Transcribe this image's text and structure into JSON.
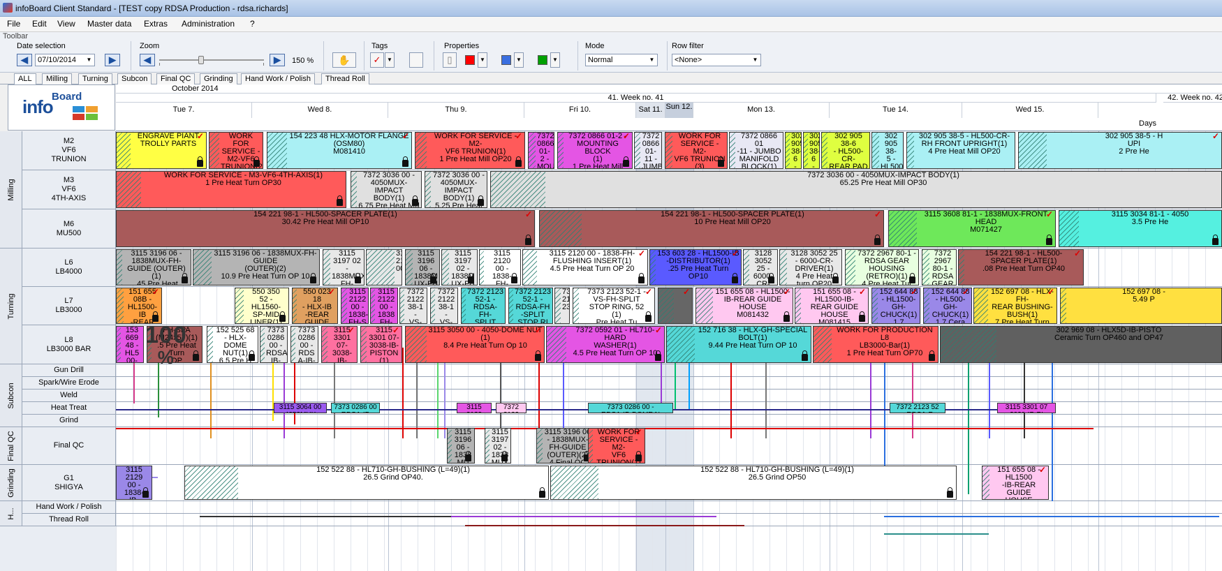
{
  "window": {
    "title": "infoBoard Client Standard - [TEST copy RDSA Production - rdsa.richards]"
  },
  "menu": [
    "File",
    "Edit",
    "View",
    "Master data",
    "Extras",
    "Administration",
    "?"
  ],
  "toolbar": {
    "label": "Toolbar",
    "date_selection": {
      "label": "Date selection",
      "value": "07/10/2014"
    },
    "zoom": {
      "label": "Zoom",
      "value": "150 %",
      "level_fraction": 0.4
    },
    "tags": {
      "label": "Tags"
    },
    "properties": {
      "label": "Properties",
      "colors": [
        "#ff0000",
        "#3a6fe0",
        "#00a000"
      ]
    },
    "mode": {
      "label": "Mode",
      "value": "Normal"
    },
    "row_filter": {
      "label": "Row filter",
      "value": "<None>"
    }
  },
  "tabs": [
    "ALL",
    "Milling",
    "Turning",
    "Subcon",
    "Final QC",
    "Grinding",
    "Hand Work / Polish",
    "Thread Roll"
  ],
  "logo": {
    "text_main": "info",
    "text_sup": "Board"
  },
  "timeline": {
    "month": "October 2014",
    "weeks": [
      {
        "label": "41. Week no. 41"
      },
      {
        "label": "42. Week no. 42"
      }
    ],
    "days": [
      "Tue 7.",
      "Wed 8.",
      "Thu 9.",
      "Fri 10.",
      "Sat 11.",
      "Sun 12.",
      "Mon 13.",
      "Tue 14.",
      "Wed 15."
    ],
    "unit": "Days"
  },
  "groups": [
    "Milling",
    "Turning",
    "Subcon",
    "Final QC",
    "Grinding",
    "H..."
  ],
  "rows": [
    {
      "label": "M2\nVF6\nTRUNION"
    },
    {
      "label": "M3\nVF6\n4TH-AXIS"
    },
    {
      "label": "M6\nMU500"
    },
    {
      "label": "L6\nLB4000"
    },
    {
      "label": "L7\nLB3000"
    },
    {
      "label": "L8\nLB3000 BAR"
    },
    {
      "label": "Gun Drill"
    },
    {
      "label": "Spark/Wire Erode"
    },
    {
      "label": "Weld"
    },
    {
      "label": "Heat Treat"
    },
    {
      "label": "Grind"
    },
    {
      "label": "Final QC"
    },
    {
      "label": "G1\nSHIGYA"
    },
    {
      "label": "Hand Work / Polish"
    },
    {
      "label": "Thread Roll"
    }
  ],
  "progress_overlay": {
    "value": "100",
    "unit": "%"
  },
  "jobs": [
    {
      "row": 0,
      "text": "ENGRAVE PIANT\nTROLLY PARTS",
      "color": "#ffff44"
    },
    {
      "row": 0,
      "text": "WORK FOR\nSERVICE -\nM2-VF6\nTRUNION(2)\n1 Pre Heat",
      "color": "#ff5a5a"
    },
    {
      "row": 0,
      "text": "154 223 48 HLX-MOTOR FLANGE\n(OSM80)\nM081410",
      "color": "#aaf0f4"
    },
    {
      "row": 0,
      "text": "WORK FOR SERVICE - M2-\nVF6 TRUNION(1)\n1 Pre Heat Mill OP20",
      "color": "#ff5a5a"
    },
    {
      "row": 0,
      "text": "7372\n0866\n01-2 -\nMOU\nNTI",
      "color": "#e455e4"
    },
    {
      "row": 0,
      "text": "7372 0866 01-2 -\nMOUNTING BLOCK\n(1)\n1 Pre Heat Mill\nOP20",
      "color": "#e455e4"
    },
    {
      "row": 0,
      "text": "7372\n0866\n01-11 -\nJUMBO\nMANI",
      "color": "#e8e8f4"
    },
    {
      "row": 0,
      "text": "WORK FOR\nSERVICE - M2-\nVF6 TRUNION\n(3)\n1 Pre Heat",
      "color": "#ff5a5a"
    },
    {
      "row": 0,
      "text": "7372 0866 01\n-11 - JUMBO\nMANIFOLD\nBLOCK(1)\n1 Pre Heat",
      "color": "#e8e8f4"
    },
    {
      "row": 0,
      "text": "302\n905\n38-\n6 -\nHL",
      "color": "#dfff40"
    },
    {
      "row": 0,
      "text": "302\n905\n38-\n6 -\nHL",
      "color": "#dfff40"
    },
    {
      "row": 0,
      "text": "302 905 38-6\n- HL500-CR-\nREAR PAD\n(1)\n2 Pre Heat",
      "color": "#dfff40"
    },
    {
      "row": 0,
      "text": "302\n905 38-\n5 -\nHL500-\nCR-R",
      "color": "#aaf0f4"
    },
    {
      "row": 0,
      "text": "302 905 38-5 - HL500-CR-\nRH FRONT UPRIGHT(1)\n4 Pre Heat Mill OP20",
      "color": "#aaf0f4"
    },
    {
      "row": 0,
      "text": "302 905 38-5 - H\nUPI\n2 Pre He",
      "color": "#aaf0f4"
    },
    {
      "row": 1,
      "text": "WORK FOR SERVICE - M3-VF6-4TH-AXIS(1)\n1 Pre Heat Turn OP30",
      "color": "#ff5a5a"
    },
    {
      "row": 1,
      "text": "7372 3036 00 -\n4050MUX-IMPACT\nBODY(1)\n6.75 Pre Heat Mill\nOP10",
      "color": "#e0e0e0"
    },
    {
      "row": 1,
      "text": "7372 3036 00 -\n4050MUX-\nIMPACT BODY(1)\n5.25 Pre Heat Mill\nOP20",
      "color": "#e0e0e0"
    },
    {
      "row": 1,
      "text": "7372 3036 00 - 4050MUX-IMPACT BODY(1)\n65.25 Pre Heat Mill OP30",
      "color": "#e0e0e0"
    },
    {
      "row": 2,
      "text": "154 221 98-1 - HL500-SPACER PLATE(1)\n30.42 Pre Heat Mill OP10",
      "color": "#a85a5a"
    },
    {
      "row": 2,
      "text": "154 221 98-1 - HL500-SPACER PLATE(1)\n10 Pre Heat Mill OP20",
      "color": "#a85a5a"
    },
    {
      "row": 2,
      "text": "3115 3608 81-1 - 1838MUX-FRONT HEAD\nM071427",
      "color": "#6ee85a"
    },
    {
      "row": 2,
      "text": "3115 3034 81-1 - 4050\n3.5 Pre He",
      "color": "#55f0e0"
    },
    {
      "row": 3,
      "text": "3115 3196 06 -\n1838MUX-FH-\nGUIDE (OUTER)\n(1)\n.45 Pre Heat",
      "color": "#b4b4b4"
    },
    {
      "row": 3,
      "text": "3115 3196 06 - 1838MUX-FH-GUIDE\n(OUTER)(2)\n10.9 Pre Heat Turn OP 10",
      "color": "#b4b4b4"
    },
    {
      "row": 3,
      "text": "3115 3197 02\n- 1838MUX-\nFH-GUIDE\n(INNER)(2)\n4 Pre Hea",
      "color": "#e8e8e8"
    },
    {
      "row": 3,
      "text": "3115\n2120\n00",
      "color": "#e8e8e8"
    },
    {
      "row": 3,
      "text": "3115\n3196\n06 -\n1838M\nUX-FH",
      "color": "#b4b4b4"
    },
    {
      "row": 3,
      "text": "3115\n3197\n02 -\n1838M\nUX-FH",
      "color": "#e8e8e8"
    },
    {
      "row": 3,
      "text": "3115 2120\n00 - 1838-\nFH-\nFLUSHIN\nG INSERT",
      "color": "#ffffff"
    },
    {
      "row": 3,
      "text": "3115 2120 00 - 1838-FH-\nFLUSHING INSERT(1)\n4.5 Pre Heat Turn OP 20",
      "color": "#ffffff"
    },
    {
      "row": 3,
      "text": "153 603 28 - HL1500-IB\n-DISTRIBUTOR(1)\n.25 Pre Heat Turn\nOP10",
      "color": "#5a5aff"
    },
    {
      "row": 3,
      "text": "3128\n3052 25 -\n6000-CR-\nDRIVER\n(1)",
      "color": "#e8e8e8"
    },
    {
      "row": 3,
      "text": "3128 3052 25\n- 6000-CR-\nDRIVER(1)\n4 Pre Heat\nturn OP20",
      "color": "#e8e8e8"
    },
    {
      "row": 3,
      "text": "7372 2967 80-1 -\nRDSA GEAR\nHOUSING\n(RETRO)(1)\n4 Pre Heat Tur",
      "color": "#e8ffe0"
    },
    {
      "row": 3,
      "text": "7372\n2967\n80-1 -\nRDSA\nGEAR",
      "color": "#e8ffe0"
    },
    {
      "row": 3,
      "text": "154 221 98-1 - HL500-\nSPACER PLATE(1)\n.08 Pre Heat Turn OP40",
      "color": "#a85a5a"
    },
    {
      "row": 4,
      "text": "151 655\n08B -\nHL1500-IB\n-REAR\nGUIDE",
      "color": "#ffa040"
    },
    {
      "row": 4,
      "text": "550 350\n52 -\nHL1560-\nSP-MID\nLINER(1)",
      "color": "#ffffcc"
    },
    {
      "row": 4,
      "text": "550 023 18\n- HLX-IB\n-REAR\nGUIDE\nBUSH",
      "color": "#e0a060"
    },
    {
      "row": 4,
      "text": "3115\n2122\n00 -\n1838-\nFH-S",
      "color": "#e455e4"
    },
    {
      "row": 4,
      "text": "3115\n2122\n00 -\n1838\nFH-",
      "color": "#e455e4"
    },
    {
      "row": 4,
      "text": "7372\n2122\n38-1 -\nVS-FH\nSTOP",
      "color": "#e8e8e8"
    },
    {
      "row": 4,
      "text": "7372\n2122\n38-1 -\nVS-\nFH",
      "color": "#e8e8e8"
    },
    {
      "row": 4,
      "text": "7372 2123\n52-1 -\nRDSA-FH-\nSPLIT\nSTOP RING",
      "color": "#55d8d8"
    },
    {
      "row": 4,
      "text": "7372 2123\n52-1 -\nRDSA-FH\n-SPLIT\nSTOP RI",
      "color": "#55d8d8"
    },
    {
      "row": 4,
      "text": "73\n21\n23",
      "color": "#e8e8e8"
    },
    {
      "row": 4,
      "text": "7373 2123 52-1 -\nVS-FH-SPLIT\nSTOP RING, 52\n(1)\nPre Heat Tu",
      "color": "#ffffff"
    },
    {
      "row": 4,
      "text": "",
      "color": "#666666"
    },
    {
      "row": 4,
      "text": "151 655 08 - HL1500-\nIB-REAR GUIDE\nHOUSE\nM081432",
      "color": "#ffc8f0"
    },
    {
      "row": 4,
      "text": "151 655 08 -\nHL1500-IB-\nREAR GUIDE\nHOUSE\nM081415",
      "color": "#ffc8f0"
    },
    {
      "row": 4,
      "text": "152 644 88\n- HL1500-GH-\nCHUCK(1)\n1.7 Ceramic\nTurn OP40",
      "color": "#9a88e8"
    },
    {
      "row": 4,
      "text": "152 644 88\n- HL500-\nGH-\nCHUCK(1)\n1.7 Cera",
      "color": "#9a88e8"
    },
    {
      "row": 4,
      "text": "152 697 08 - HLX-FH-\nREAR BUSHING-\nBUSH(1)\n7 Pre Heat Turn OP\n10",
      "color": "#ffe040"
    },
    {
      "row": 4,
      "text": "152 697 08 -\n5.49 P",
      "color": "#ffe040"
    },
    {
      "row": 5,
      "text": "153\n669\n48 -\nHL5\n00-",
      "color": "#e455e4"
    },
    {
      "row": 5,
      "text": "FH-SPA\n(M24x57)(1)\n.5 Pre Heat Turn\nOP",
      "color": "#a85a5a"
    },
    {
      "row": 5,
      "text": "152 525 68\n- HLX-\nDOME\nNUT(1)\n6.5 Pre H",
      "color": "#ffffff"
    },
    {
      "row": 5,
      "text": "7373\n0286\n00 -\nRDSA-\nIB-DO",
      "color": "#e8e8e8"
    },
    {
      "row": 5,
      "text": "7373\n0286\n00 -\nRDS\nA-IB-",
      "color": "#e8e8e8"
    },
    {
      "row": 5,
      "text": "3115\n3301 07-\n3038-IB-\nPISTON\n(1)",
      "color": "#ff70a0"
    },
    {
      "row": 5,
      "text": "3115\n3301 07-\n3038-IB-\nPISTON\n(1)",
      "color": "#ff70a0"
    },
    {
      "row": 5,
      "text": "3115 3050 00 - 4050-DOME NUT\n(1)\n8.4 Pre Heat Turn Op 10",
      "color": "#ff5a5a"
    },
    {
      "row": 5,
      "text": "7372 0592 01 - HL710-HARD\nWASHER(1)\n4.5 Pre Heat Turn OP 10",
      "color": "#e455e4"
    },
    {
      "row": 5,
      "text": "152 716 38 - HLX-GH-SPECIAL\nBOLT(1)\n9.44 Pre Heat Turn OP 10",
      "color": "#55d8d8"
    },
    {
      "row": 5,
      "text": "WORK FOR PRODUCTION L8\nLB3000-Bar(1)\n1 Pre Heat Turn OP70",
      "color": "#ff5a5a"
    },
    {
      "row": 5,
      "text": "302 969 08 - HLX5D-IB-PISTO\nCeramic Turn OP460 and OP47",
      "color": "#606060"
    },
    {
      "row": 9,
      "text": "3115 3064 00\n4050MUX",
      "color": "#9a5af0"
    },
    {
      "row": 9,
      "text": "7373 0286 00\nRDSA-IB",
      "color": "#55d8d8"
    },
    {
      "row": 9,
      "text": "3115\n2122",
      "color": "#e455e4"
    },
    {
      "row": 9,
      "text": "7372\n2122",
      "color": "#ffc8f0"
    },
    {
      "row": 9,
      "text": "7373 0286 00 -\nRDSA-IB-DOME N",
      "color": "#55d8d8"
    },
    {
      "row": 9,
      "text": "7372 2123 52\n- RDSA-F",
      "color": "#55d8d8"
    },
    {
      "row": 9,
      "text": "3115 3301 07\n3038-IB-PI",
      "color": "#e455e4"
    },
    {
      "row": 11,
      "text": "3115\n3197\n02 -\n1838\nMUX",
      "color": "#e8e8e8"
    },
    {
      "row": 11,
      "text": "3115\n3196\n06 -\n1838\nMU",
      "color": "#b4b4b4"
    },
    {
      "row": 11,
      "text": "3115 3196 06\n- 1838MUX-\nFH-GUIDE\n(OUTER)(2)\n4 Final QC",
      "color": "#b4b4b4"
    },
    {
      "row": 11,
      "text": "WORK FOR\nSERVICE - M2-\nVF6 TRUNION(1)\n1 Final QC\nOP700",
      "color": "#ff5a5a"
    },
    {
      "row": 12,
      "text": "3115 2129\n00 - 1838-\nIB-PISTON\n(ME)\nM061452",
      "color": "#9a88e8"
    },
    {
      "row": 12,
      "text": "152 522 88 - HL710-GH-BUSHING (L=49)(1)\n26.5 Grind OP40.",
      "color": "#ffffff"
    },
    {
      "row": 12,
      "text": "152 522 88 - HL710-GH-BUSHING (L=49)(1)\n26.5 Grind OP50",
      "color": "#ffffff"
    },
    {
      "row": 12,
      "text": "151 655 08 - HL1500\n-IB-REAR GUIDE\nHOUSE\nM081415",
      "color": "#ffc8f0"
    }
  ]
}
